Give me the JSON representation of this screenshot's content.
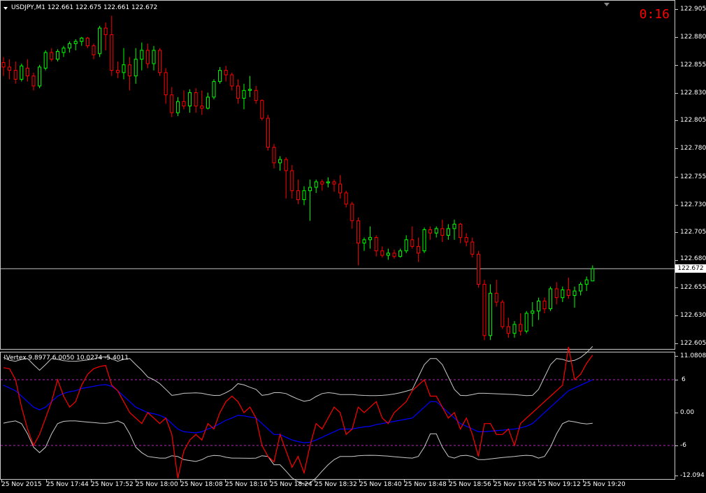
{
  "header": {
    "symbol_info": "USDJPY,M1  122.661 122.675 122.661 122.672",
    "timer": "0:16"
  },
  "price_axis": {
    "labels": [
      "122.905",
      "122.880",
      "122.855",
      "122.830",
      "122.805",
      "122.780",
      "122.755",
      "122.730",
      "122.705",
      "122.680",
      "122.655",
      "122.630",
      "122.605"
    ],
    "current_price": "122.672"
  },
  "indicator": {
    "title": "!Vertex 9.8977 6.0050 10.0274 -5.4011",
    "axis_labels": [
      "11.0808",
      "6",
      "0.00",
      "-6",
      "-12.094"
    ]
  },
  "time_axis": {
    "labels": [
      "25 Nov 2015",
      "25 Nov 17:44",
      "25 Nov 17:52",
      "25 Nov 18:00",
      "25 Nov 18:08",
      "25 Nov 18:16",
      "25 Nov 18:24",
      "25 Nov 18:32",
      "25 Nov 18:40",
      "25 Nov 18:48",
      "25 Nov 18:56",
      "25 Nov 19:04",
      "25 Nov 19:12",
      "25 Nov 19:20"
    ]
  },
  "colors": {
    "bull": "#00ff00",
    "bear": "#ff0000",
    "indicator_main": "#ff0000",
    "indicator_signal": "#0000ff",
    "bands": "#c8c8c8",
    "levels": "#c020c0",
    "current_line": "#c0c0c0"
  },
  "chart_data": {
    "type": "candlestick",
    "ohlc": [
      {
        "o": 122.857,
        "h": 122.862,
        "l": 122.845,
        "c": 122.853
      },
      {
        "o": 122.853,
        "h": 122.86,
        "l": 122.842,
        "c": 122.85
      },
      {
        "o": 122.85,
        "h": 122.858,
        "l": 122.838,
        "c": 122.842
      },
      {
        "o": 122.842,
        "h": 122.856,
        "l": 122.84,
        "c": 122.854
      },
      {
        "o": 122.852,
        "h": 122.86,
        "l": 122.84,
        "c": 122.845
      },
      {
        "o": 122.845,
        "h": 122.848,
        "l": 122.832,
        "c": 122.836
      },
      {
        "o": 122.836,
        "h": 122.855,
        "l": 122.834,
        "c": 122.853
      },
      {
        "o": 122.852,
        "h": 122.868,
        "l": 122.85,
        "c": 122.866
      },
      {
        "o": 122.866,
        "h": 122.87,
        "l": 122.858,
        "c": 122.86
      },
      {
        "o": 122.86,
        "h": 122.869,
        "l": 122.858,
        "c": 122.867
      },
      {
        "o": 122.866,
        "h": 122.872,
        "l": 122.862,
        "c": 122.87
      },
      {
        "o": 122.87,
        "h": 122.876,
        "l": 122.866,
        "c": 122.874
      },
      {
        "o": 122.874,
        "h": 122.878,
        "l": 122.868,
        "c": 122.876
      },
      {
        "o": 122.876,
        "h": 122.88,
        "l": 122.872,
        "c": 122.879
      },
      {
        "o": 122.879,
        "h": 122.88,
        "l": 122.87,
        "c": 122.872
      },
      {
        "o": 122.872,
        "h": 122.874,
        "l": 122.86,
        "c": 122.864
      },
      {
        "o": 122.865,
        "h": 122.89,
        "l": 122.862,
        "c": 122.888
      },
      {
        "o": 122.888,
        "h": 122.893,
        "l": 122.868,
        "c": 122.882
      },
      {
        "o": 122.882,
        "h": 122.899,
        "l": 122.845,
        "c": 122.85
      },
      {
        "o": 122.85,
        "h": 122.858,
        "l": 122.843,
        "c": 122.848
      },
      {
        "o": 122.848,
        "h": 122.87,
        "l": 122.842,
        "c": 122.855
      },
      {
        "o": 122.855,
        "h": 122.862,
        "l": 122.832,
        "c": 122.845
      },
      {
        "o": 122.845,
        "h": 122.87,
        "l": 122.838,
        "c": 122.86
      },
      {
        "o": 122.86,
        "h": 122.875,
        "l": 122.85,
        "c": 122.868
      },
      {
        "o": 122.868,
        "h": 122.874,
        "l": 122.852,
        "c": 122.856
      },
      {
        "o": 122.856,
        "h": 122.872,
        "l": 122.85,
        "c": 122.868
      },
      {
        "o": 122.868,
        "h": 122.87,
        "l": 122.845,
        "c": 122.848
      },
      {
        "o": 122.848,
        "h": 122.852,
        "l": 122.82,
        "c": 122.828
      },
      {
        "o": 122.828,
        "h": 122.835,
        "l": 122.808,
        "c": 122.812
      },
      {
        "o": 122.812,
        "h": 122.826,
        "l": 122.809,
        "c": 122.822
      },
      {
        "o": 122.822,
        "h": 122.832,
        "l": 122.815,
        "c": 122.818
      },
      {
        "o": 122.818,
        "h": 122.833,
        "l": 122.812,
        "c": 122.83
      },
      {
        "o": 122.83,
        "h": 122.834,
        "l": 122.812,
        "c": 122.818
      },
      {
        "o": 122.818,
        "h": 122.832,
        "l": 122.81,
        "c": 122.816
      },
      {
        "o": 122.816,
        "h": 122.83,
        "l": 122.815,
        "c": 122.826
      },
      {
        "o": 122.826,
        "h": 122.842,
        "l": 122.824,
        "c": 122.84
      },
      {
        "o": 122.84,
        "h": 122.853,
        "l": 122.838,
        "c": 122.85
      },
      {
        "o": 122.85,
        "h": 122.854,
        "l": 122.84,
        "c": 122.846
      },
      {
        "o": 122.846,
        "h": 122.848,
        "l": 122.832,
        "c": 122.836
      },
      {
        "o": 122.836,
        "h": 122.842,
        "l": 122.82,
        "c": 122.825
      },
      {
        "o": 122.825,
        "h": 122.838,
        "l": 122.815,
        "c": 122.832
      },
      {
        "o": 122.832,
        "h": 122.845,
        "l": 122.826,
        "c": 122.833
      },
      {
        "o": 122.832,
        "h": 122.836,
        "l": 122.82,
        "c": 122.823
      },
      {
        "o": 122.823,
        "h": 122.824,
        "l": 122.805,
        "c": 122.807
      },
      {
        "o": 122.807,
        "h": 122.81,
        "l": 122.778,
        "c": 122.781
      },
      {
        "o": 122.781,
        "h": 122.784,
        "l": 122.762,
        "c": 122.767
      },
      {
        "o": 122.767,
        "h": 122.773,
        "l": 122.76,
        "c": 122.77
      },
      {
        "o": 122.77,
        "h": 122.772,
        "l": 122.735,
        "c": 122.76
      },
      {
        "o": 122.76,
        "h": 122.765,
        "l": 122.735,
        "c": 122.742
      },
      {
        "o": 122.742,
        "h": 122.752,
        "l": 122.73,
        "c": 122.734
      },
      {
        "o": 122.734,
        "h": 122.746,
        "l": 122.729,
        "c": 122.742
      },
      {
        "o": 122.742,
        "h": 122.752,
        "l": 122.715,
        "c": 122.745
      },
      {
        "o": 122.745,
        "h": 122.752,
        "l": 122.74,
        "c": 122.75
      },
      {
        "o": 122.75,
        "h": 122.752,
        "l": 122.742,
        "c": 122.748
      },
      {
        "o": 122.749,
        "h": 122.754,
        "l": 122.745,
        "c": 122.75
      },
      {
        "o": 122.75,
        "h": 122.752,
        "l": 122.741,
        "c": 122.748
      },
      {
        "o": 122.748,
        "h": 122.756,
        "l": 122.735,
        "c": 122.74
      },
      {
        "o": 122.74,
        "h": 122.742,
        "l": 122.727,
        "c": 122.73
      },
      {
        "o": 122.73,
        "h": 122.732,
        "l": 122.708,
        "c": 122.715
      },
      {
        "o": 122.715,
        "h": 122.718,
        "l": 122.675,
        "c": 122.695
      },
      {
        "o": 122.695,
        "h": 122.7,
        "l": 122.688,
        "c": 122.698
      },
      {
        "o": 122.698,
        "h": 122.71,
        "l": 122.69,
        "c": 122.7
      },
      {
        "o": 122.7,
        "h": 122.702,
        "l": 122.683,
        "c": 122.688
      },
      {
        "o": 122.688,
        "h": 122.692,
        "l": 122.682,
        "c": 122.684
      },
      {
        "o": 122.684,
        "h": 122.69,
        "l": 122.68,
        "c": 122.686
      },
      {
        "o": 122.686,
        "h": 122.689,
        "l": 122.681,
        "c": 122.683
      },
      {
        "o": 122.683,
        "h": 122.69,
        "l": 122.682,
        "c": 122.688
      },
      {
        "o": 122.688,
        "h": 122.702,
        "l": 122.686,
        "c": 122.698
      },
      {
        "o": 122.698,
        "h": 122.71,
        "l": 122.69,
        "c": 122.692
      },
      {
        "o": 122.692,
        "h": 122.7,
        "l": 122.678,
        "c": 122.686
      },
      {
        "o": 122.688,
        "h": 122.709,
        "l": 122.686,
        "c": 122.707
      },
      {
        "o": 122.707,
        "h": 122.71,
        "l": 122.698,
        "c": 122.704
      },
      {
        "o": 122.704,
        "h": 122.71,
        "l": 122.7,
        "c": 122.708
      },
      {
        "o": 122.708,
        "h": 122.716,
        "l": 122.696,
        "c": 122.702
      },
      {
        "o": 122.702,
        "h": 122.712,
        "l": 122.698,
        "c": 122.708
      },
      {
        "o": 122.708,
        "h": 122.716,
        "l": 122.698,
        "c": 122.712
      },
      {
        "o": 122.712,
        "h": 122.713,
        "l": 122.695,
        "c": 122.7
      },
      {
        "o": 122.7,
        "h": 122.704,
        "l": 122.692,
        "c": 122.696
      },
      {
        "o": 122.696,
        "h": 122.7,
        "l": 122.682,
        "c": 122.685
      },
      {
        "o": 122.685,
        "h": 122.688,
        "l": 122.655,
        "c": 122.658
      },
      {
        "o": 122.658,
        "h": 122.662,
        "l": 122.608,
        "c": 122.612
      },
      {
        "o": 122.612,
        "h": 122.658,
        "l": 122.608,
        "c": 122.65
      },
      {
        "o": 122.65,
        "h": 122.662,
        "l": 122.638,
        "c": 122.642
      },
      {
        "o": 122.642,
        "h": 122.644,
        "l": 122.618,
        "c": 122.62
      },
      {
        "o": 122.62,
        "h": 122.628,
        "l": 122.61,
        "c": 122.614
      },
      {
        "o": 122.614,
        "h": 122.625,
        "l": 122.61,
        "c": 122.622
      },
      {
        "o": 122.622,
        "h": 122.632,
        "l": 122.612,
        "c": 122.616
      },
      {
        "o": 122.616,
        "h": 122.634,
        "l": 122.614,
        "c": 122.632
      },
      {
        "o": 122.632,
        "h": 122.642,
        "l": 122.62,
        "c": 122.634
      },
      {
        "o": 122.634,
        "h": 122.646,
        "l": 122.626,
        "c": 122.643
      },
      {
        "o": 122.643,
        "h": 122.646,
        "l": 122.632,
        "c": 122.636
      },
      {
        "o": 122.636,
        "h": 122.656,
        "l": 122.634,
        "c": 122.654
      },
      {
        "o": 122.654,
        "h": 122.66,
        "l": 122.64,
        "c": 122.646
      },
      {
        "o": 122.646,
        "h": 122.656,
        "l": 122.642,
        "c": 122.653
      },
      {
        "o": 122.653,
        "h": 122.664,
        "l": 122.645,
        "c": 122.648
      },
      {
        "o": 122.648,
        "h": 122.656,
        "l": 122.637,
        "c": 122.652
      },
      {
        "o": 122.652,
        "h": 122.66,
        "l": 122.648,
        "c": 122.658
      },
      {
        "o": 122.658,
        "h": 122.665,
        "l": 122.652,
        "c": 122.662
      },
      {
        "o": 122.661,
        "h": 122.675,
        "l": 122.661,
        "c": 122.672
      }
    ],
    "y_range": [
      122.6,
      122.91
    ],
    "indicator": {
      "range": [
        -12.094,
        11.0808
      ],
      "levels": [
        6,
        -6
      ],
      "main": [
        8.2,
        8,
        6,
        1,
        -3,
        -6,
        -4,
        -1,
        2,
        6,
        3,
        1,
        2,
        5,
        7,
        8,
        8.4,
        8.6,
        5,
        4,
        2,
        0,
        -1,
        -2,
        0,
        -1,
        -2,
        -1,
        -4,
        -12,
        -7,
        -5,
        -4,
        -5,
        -2,
        -3,
        0,
        2,
        3,
        2,
        0,
        1,
        -1,
        -6,
        -8,
        -9,
        -4,
        -7,
        -10,
        -8,
        -11,
        -6,
        -2,
        -3,
        -1,
        1,
        0,
        -4,
        -3,
        1,
        0,
        1,
        2,
        -1,
        -2,
        0,
        1,
        2,
        4,
        5,
        6,
        3,
        3,
        1,
        -1,
        0,
        -3,
        -1,
        -4,
        -8,
        -2,
        -2,
        -4,
        -4,
        -3,
        -6,
        -2,
        -1,
        0,
        1,
        2,
        3,
        4,
        5,
        12,
        6,
        7,
        9,
        10.5
      ],
      "signal": [
        5,
        4.5,
        4,
        3,
        2,
        1,
        0.5,
        1,
        2,
        3,
        3.5,
        3.8,
        4,
        4.4,
        4.6,
        4.8,
        5,
        5.1,
        4.8,
        4,
        3,
        2,
        1,
        0.5,
        0,
        -0.2,
        -0.5,
        -1,
        -2,
        -3,
        -3.5,
        -3.6,
        -3.7,
        -3.5,
        -3,
        -2.6,
        -2,
        -1.4,
        -1,
        -0.5,
        -0.6,
        -0.8,
        -1,
        -2,
        -3,
        -4,
        -4,
        -4.5,
        -5,
        -5.3,
        -5.5,
        -5.4,
        -5,
        -4.5,
        -4,
        -3.5,
        -3,
        -3,
        -3,
        -2.8,
        -2.6,
        -2.5,
        -2.2,
        -2,
        -1.8,
        -1.6,
        -1.4,
        -1.2,
        -1,
        0,
        1,
        2,
        2,
        1,
        0,
        -1,
        -2,
        -2.5,
        -3,
        -3.5,
        -3.5,
        -3.4,
        -3.3,
        -3.2,
        -3.1,
        -3,
        -2.8,
        -2.5,
        -2,
        -1,
        0,
        1,
        2,
        3,
        4,
        4.5,
        5,
        5.5,
        6
      ]
    }
  }
}
